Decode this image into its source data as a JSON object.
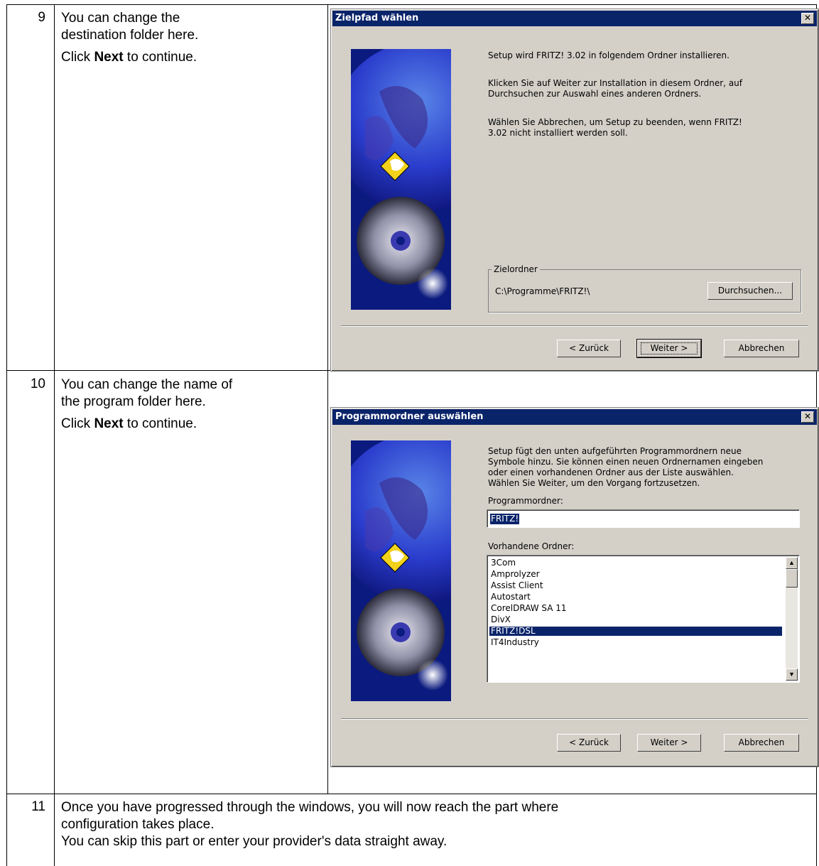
{
  "rows": [
    {
      "number": "9",
      "line1": "You can change the",
      "line2": "destination folder here.",
      "click_pre": "Click ",
      "click_bold": "Next",
      "click_post": " to continue."
    },
    {
      "number": "10",
      "line1": "You can change the name of",
      "line2": "the program folder here.",
      "click_pre": "Click ",
      "click_bold": "Next",
      "click_post": " to continue."
    },
    {
      "number": "11",
      "line1": "Once you have progressed through the windows, you will now reach the part where",
      "line2": "configuration takes place.",
      "line3": "You can skip this part or enter your provider's data straight away."
    }
  ],
  "dialog1": {
    "title": "Zielpfad wählen",
    "close": "✕",
    "para1": "Setup wird FRITZ! 3.02 in folgendem Ordner installieren.",
    "para2a": "Klicken Sie auf Weiter zur Installation in diesem Ordner, auf",
    "para2b": "Durchsuchen zur Auswahl eines anderen Ordners.",
    "para3a": "Wählen Sie Abbrechen, um Setup zu beenden, wenn FRITZ!",
    "para3b": "3.02 nicht installiert werden soll.",
    "group_label": "Zielordner",
    "path": "C:\\Programme\\FRITZ!\\",
    "browse": "Durchsuchen...",
    "back": "< Zurück",
    "next": "Weiter >",
    "cancel": "Abbrechen"
  },
  "dialog2": {
    "title": "Programmordner auswählen",
    "close": "✕",
    "para1": "Setup fügt den unten aufgeführten Programmordnern neue",
    "para2": "Symbole hinzu. Sie können einen neuen Ordnernamen eingeben",
    "para3": "oder einen vorhandenen Ordner aus der Liste auswählen.",
    "para4": "Wählen Sie Weiter, um den Vorgang fortzusetzen.",
    "folder_label": "Programmordner:",
    "folder_value": "FRITZ!",
    "existing_label": "Vorhandene Ordner:",
    "existing": [
      "3Com",
      "Amprolyzer",
      "Assist Client",
      "Autostart",
      "CorelDRAW SA 11",
      "DivX",
      "FRITZ!DSL",
      "IT4Industry"
    ],
    "selected_item": "FRITZ!DSL",
    "back": "< Zurück",
    "next": "Weiter >",
    "cancel": "Abbrechen"
  }
}
